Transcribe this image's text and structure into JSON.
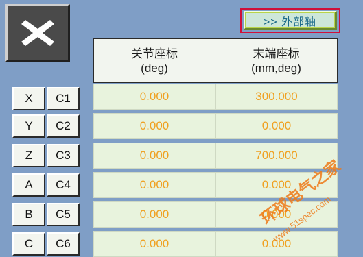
{
  "close_button": {
    "icon": "close-icon",
    "color": "#ffffff"
  },
  "external_axis_button": {
    "label": ">> 外部轴"
  },
  "headers": {
    "joint": {
      "title": "关节座标",
      "unit": "(deg)"
    },
    "end": {
      "title": "末端座标",
      "unit": "(mm,deg)"
    }
  },
  "rows": [
    {
      "axis_a": "X",
      "axis_b": "C1",
      "joint": "0.000",
      "end": "300.000"
    },
    {
      "axis_a": "Y",
      "axis_b": "C2",
      "joint": "0.000",
      "end": "0.000"
    },
    {
      "axis_a": "Z",
      "axis_b": "C3",
      "joint": "0.000",
      "end": "700.000"
    },
    {
      "axis_a": "A",
      "axis_b": "C4",
      "joint": "0.000",
      "end": "0.000"
    },
    {
      "axis_a": "B",
      "axis_b": "C5",
      "joint": "0.000",
      "end": "0.000"
    },
    {
      "axis_a": "C",
      "axis_b": "C6",
      "joint": "0.000",
      "end": "0.000"
    }
  ],
  "watermark": {
    "text": "环球电气之家",
    "url": "www.51spec.com"
  },
  "colors": {
    "background": "#7f9ec6",
    "value_text": "#f0a020",
    "cell_bg": "#e8f3dd",
    "ext_button_border": "#d0103a"
  }
}
